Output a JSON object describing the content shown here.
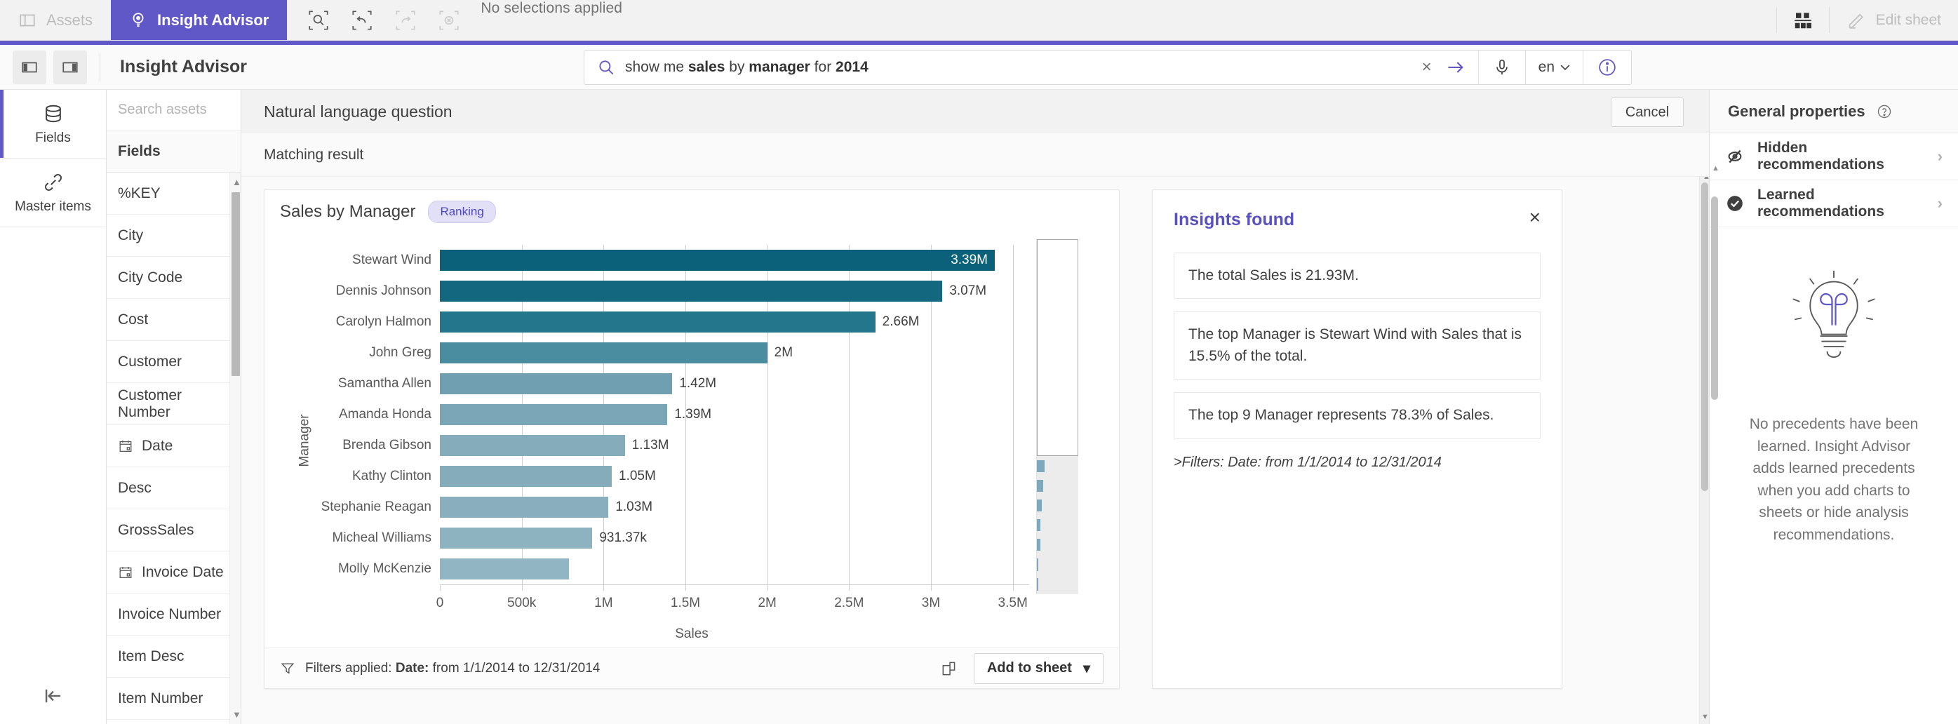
{
  "topbar": {
    "assets_label": "Assets",
    "insight_advisor_label": "Insight Advisor",
    "selections_status": "No selections applied",
    "edit_sheet_label": "Edit sheet",
    "tools": [
      {
        "name": "selection-search-icon"
      },
      {
        "name": "step-back-icon"
      },
      {
        "name": "step-forward-icon"
      },
      {
        "name": "clear-selections-icon"
      }
    ]
  },
  "search": {
    "title": "Insight Advisor",
    "query_plain": "show me sales by manager for 2014",
    "query_parts": [
      {
        "text": "show me ",
        "bold": false
      },
      {
        "text": "sales",
        "bold": true
      },
      {
        "text": " by ",
        "bold": false
      },
      {
        "text": "manager",
        "bold": true
      },
      {
        "text": " for ",
        "bold": false
      },
      {
        "text": "2014",
        "bold": true
      }
    ],
    "language": "en",
    "clear_label": "×"
  },
  "rail": {
    "items": [
      {
        "label": "Fields",
        "icon": "database-icon",
        "active": true
      },
      {
        "label": "Master items",
        "icon": "link-icon",
        "active": false
      }
    ]
  },
  "assets": {
    "search_placeholder": "Search assets",
    "section_header": "Fields",
    "fields": [
      {
        "label": "%KEY",
        "icon": null
      },
      {
        "label": "City",
        "icon": null
      },
      {
        "label": "City Code",
        "icon": null
      },
      {
        "label": "Cost",
        "icon": null
      },
      {
        "label": "Customer",
        "icon": null
      },
      {
        "label": "Customer Number",
        "icon": null
      },
      {
        "label": "Date",
        "icon": "calendar-icon"
      },
      {
        "label": "Desc",
        "icon": null
      },
      {
        "label": "GrossSales",
        "icon": null
      },
      {
        "label": "Invoice Date",
        "icon": "calendar-icon"
      },
      {
        "label": "Invoice Number",
        "icon": null
      },
      {
        "label": "Item Desc",
        "icon": null
      },
      {
        "label": "Item Number",
        "icon": null
      }
    ]
  },
  "main": {
    "nlq_title": "Natural language question",
    "cancel_label": "Cancel",
    "matching_result_label": "Matching result"
  },
  "chart_card": {
    "title": "Sales by Manager",
    "badge": "Ranking",
    "filters_prefix": "Filters applied:",
    "filters_field": "Date:",
    "filters_value": "from 1/1/2014 to 12/31/2014",
    "add_to_sheet_label": "Add to sheet",
    "caret": "▾"
  },
  "chart_data": {
    "type": "bar",
    "orientation": "horizontal",
    "title": "Sales by Manager",
    "xlabel": "Sales",
    "ylabel": "Manager",
    "xlim": [
      0,
      3600000
    ],
    "xticks": [
      0,
      500000,
      1000000,
      1500000,
      2000000,
      2500000,
      3000000,
      3500000
    ],
    "xtick_labels": [
      "0",
      "500k",
      "1M",
      "1.5M",
      "2M",
      "2.5M",
      "3M",
      "3.5M"
    ],
    "grid": true,
    "legend": false,
    "categories": [
      "Stewart Wind",
      "Dennis Johnson",
      "Carolyn Halmon",
      "John Greg",
      "Samantha Allen",
      "Amanda Honda",
      "Brenda Gibson",
      "Kathy Clinton",
      "Stephanie Reagan",
      "Micheal Williams",
      "Molly McKenzie"
    ],
    "values": [
      3390000,
      3070000,
      2660000,
      2000000,
      1420000,
      1390000,
      1130000,
      1050000,
      1030000,
      931370,
      790000
    ],
    "value_labels": [
      "3.39M",
      "3.07M",
      "2.66M",
      "2M",
      "1.42M",
      "1.39M",
      "1.13M",
      "1.05M",
      "1.03M",
      "931.37k",
      ""
    ],
    "bar_colors": [
      "#0a6179",
      "#136880",
      "#24768c",
      "#4a8da0",
      "#6f9fb1",
      "#7aa6b7",
      "#84acbb",
      "#84acbb",
      "#89afbe",
      "#8db2c0",
      "#92b5c3"
    ],
    "minimap_values": [
      3390000,
      3070000,
      2660000,
      2000000,
      1420000,
      1390000,
      1130000,
      1050000,
      1030000,
      931370,
      790000,
      700000,
      600000,
      430000,
      330000,
      320000,
      120000,
      110000
    ],
    "minimap_visible_count": 11
  },
  "insights": {
    "title": "Insights found",
    "close_label": "×",
    "items": [
      "The total Sales is 21.93M.",
      "The top Manager is Stewart Wind with Sales that is 15.5% of the total.",
      "The top 9 Manager represents 78.3% of Sales."
    ],
    "filters_note": ">Filters: Date: from 1/1/2014 to 12/31/2014"
  },
  "right_panel": {
    "header": "General properties",
    "rows": [
      {
        "label": "Hidden recommendations",
        "icon": "hidden-eye-icon"
      },
      {
        "label": "Learned recommendations",
        "icon": "check-circle-icon"
      }
    ],
    "empty_message": "No precedents have been learned. Insight Advisor adds learned precedents when you add charts to sheets or hide analysis recommendations.",
    "chevron": "›"
  },
  "colors": {
    "brand_purple": "#6158c7",
    "bar_dark": "#0a6179",
    "bar_light": "#92b5c3",
    "badge_bg": "#e2e0f7"
  }
}
